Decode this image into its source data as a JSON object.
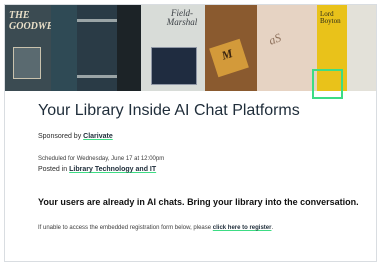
{
  "banner": {
    "book1_text": "THE GOODWES",
    "book5_text": "Field-Marshal",
    "book6_text": "M",
    "book7_text": "aS",
    "book8_text": "Lord Boyton",
    "highlight_color": "#3ddc84"
  },
  "event": {
    "title": "Your Library Inside AI Chat Platforms",
    "sponsor_prefix": "Sponsored by",
    "sponsor_name": "Clarivate",
    "scheduled": "Scheduled for Wednesday, June 17 at 12:00pm",
    "posted_prefix": "Posted in",
    "posted_category": "Library Technology and IT",
    "headline": "Your users are already in AI chats. Bring your library into the conversation.",
    "notice_prefix": "If unable to access the embedded registration form below, please",
    "notice_link": "click here to register",
    "notice_suffix": "."
  }
}
